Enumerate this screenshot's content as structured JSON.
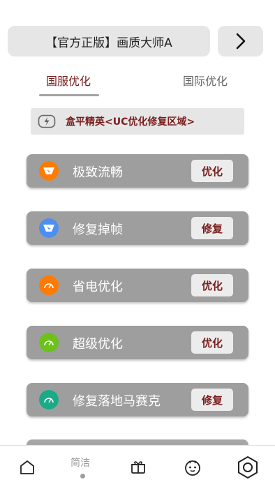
{
  "header": {
    "title": "【官方正版】画质大师A",
    "next_icon": "chevron-right-icon"
  },
  "tabs": [
    {
      "label": "国服优化",
      "active": true
    },
    {
      "label": "国际优化",
      "active": false
    }
  ],
  "notice": {
    "icon": "gamepad-icon",
    "text": "盒平精英<UC优化修复区域>"
  },
  "cards": [
    {
      "label": "极致流畅",
      "action": "优化",
      "icon": "speed-icon",
      "icon_color": "#ff7a00"
    },
    {
      "label": "修复掉帧",
      "action": "修复",
      "icon": "wrench-icon",
      "icon_color": "#4d8ff0"
    },
    {
      "label": "省电优化",
      "action": "优化",
      "icon": "gauge-icon",
      "icon_color": "#ff7a00"
    },
    {
      "label": "超级优化",
      "action": "优化",
      "icon": "gauge-icon",
      "icon_color": "#6cc218"
    },
    {
      "label": "修复落地马赛克",
      "action": "修复",
      "icon": "gauge-icon",
      "icon_color": "#1aab86"
    }
  ],
  "bottom_nav": {
    "items": [
      {
        "icon": "home-icon"
      },
      {
        "label": "简洁",
        "active": true
      },
      {
        "icon": "gift-icon"
      },
      {
        "icon": "face-icon"
      },
      {
        "icon": "settings-hexagon-icon"
      }
    ]
  },
  "colors": {
    "accent": "#7a1d1d",
    "card_bg": "#9e9e9e",
    "panel_bg": "#e6e6e6"
  }
}
